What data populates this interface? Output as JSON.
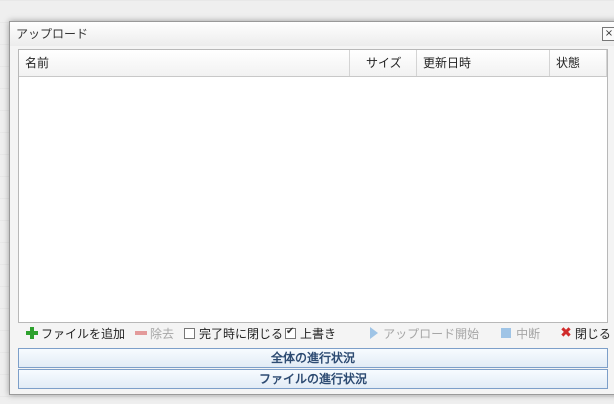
{
  "dialog": {
    "title": "アップロード",
    "close_glyph": "×"
  },
  "table": {
    "columns": [
      "名前",
      "サイズ",
      "更新日時",
      "状態"
    ]
  },
  "toolbar": {
    "add_files": "ファイルを追加",
    "remove": "除去",
    "close_on_complete": "完了時に閉じる",
    "overwrite": "上書き",
    "start_upload": "アップロード開始",
    "abort": "中断",
    "close": "閉じる"
  },
  "progress": {
    "overall_label": "全体の進行状況",
    "file_label": "ファイルの進行状況"
  },
  "colors": {
    "accent": "#2d4b72",
    "progress_border": "#7d9fc9",
    "add_green": "#2ea12e",
    "close_red": "#d02b2b"
  }
}
